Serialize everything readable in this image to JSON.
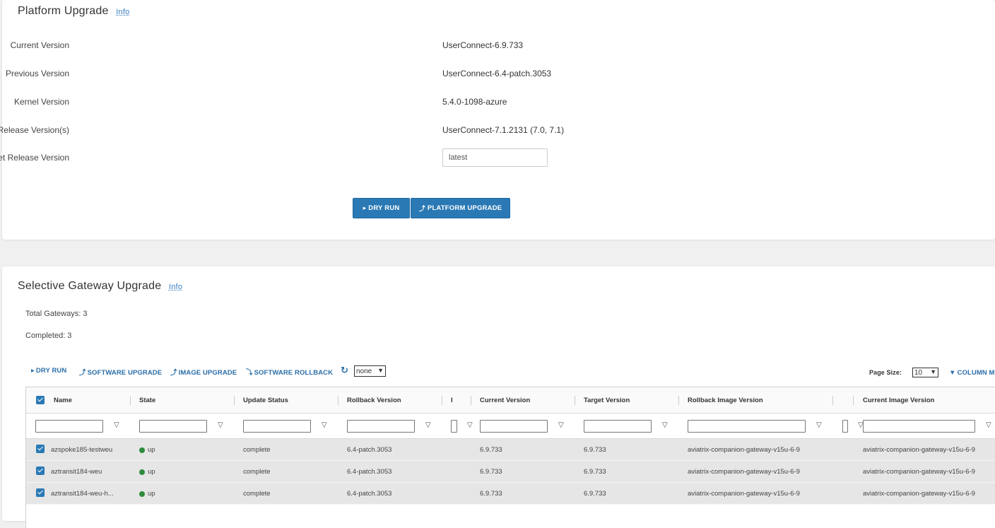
{
  "platform": {
    "title": "Platform Upgrade",
    "info": "Info",
    "fields": [
      {
        "label": "Current Version",
        "value": "UserConnect-6.9.733"
      },
      {
        "label": "Previous Version",
        "value": "UserConnect-6.4-patch.3053"
      },
      {
        "label": "Kernel Version",
        "value": "5.4.0-1098-azure"
      },
      {
        "label": "Release Version(s)",
        "value": "UserConnect-7.1.2131 (7.0, 7.1)"
      }
    ],
    "target_label": "Target Release Version",
    "target_value": "latest",
    "dry_run_label": "DRY RUN",
    "upgrade_label": "PLATFORM UPGRADE"
  },
  "gateway": {
    "title": "Selective Gateway Upgrade",
    "info": "Info",
    "total": "Total Gateways: 3",
    "completed": "Completed: 3",
    "toolbar": {
      "dry_run": "DRY RUN",
      "software_upgrade": "SOFTWARE UPGRADE",
      "image_upgrade": "IMAGE UPGRADE",
      "software_rollback": "SOFTWARE ROLLBACK",
      "filter_select": "none",
      "page_size_label": "Page Size:",
      "page_size": "10",
      "column_menu": "COLUMN MI"
    },
    "columns": [
      "Name",
      "State",
      "Update Status",
      "Rollback Version",
      "I",
      "Current Version",
      "Target Version",
      "Rollback Image Version",
      "Current Image Version"
    ],
    "rows": [
      {
        "name": "azspoke185-testweu",
        "state": "up",
        "status": "complete",
        "rollback": "6.4-patch.3053",
        "current": "6.9.733",
        "target": "6.9.733",
        "rollback_image": "aviatrix-companion-gateway-v15u-6-9",
        "current_image": "aviatrix-companion-gateway-v15u-6-9"
      },
      {
        "name": "aztransit184-weu",
        "state": "up",
        "status": "complete",
        "rollback": "6.4-patch.3053",
        "current": "6.9.733",
        "target": "6.9.733",
        "rollback_image": "aviatrix-companion-gateway-v15u-6-9",
        "current_image": "aviatrix-companion-gateway-v15u-6-9"
      },
      {
        "name": "aztransit184-weu-h...",
        "state": "up",
        "status": "complete",
        "rollback": "6.4-patch.3053",
        "current": "6.9.733",
        "target": "6.9.733",
        "rollback_image": "aviatrix-companion-gateway-v15u-6-9",
        "current_image": "aviatrix-companion-gateway-v15u-6-9"
      }
    ]
  },
  "colors": {
    "accent": "#2a79b5",
    "status_up": "#2e8b3e"
  }
}
